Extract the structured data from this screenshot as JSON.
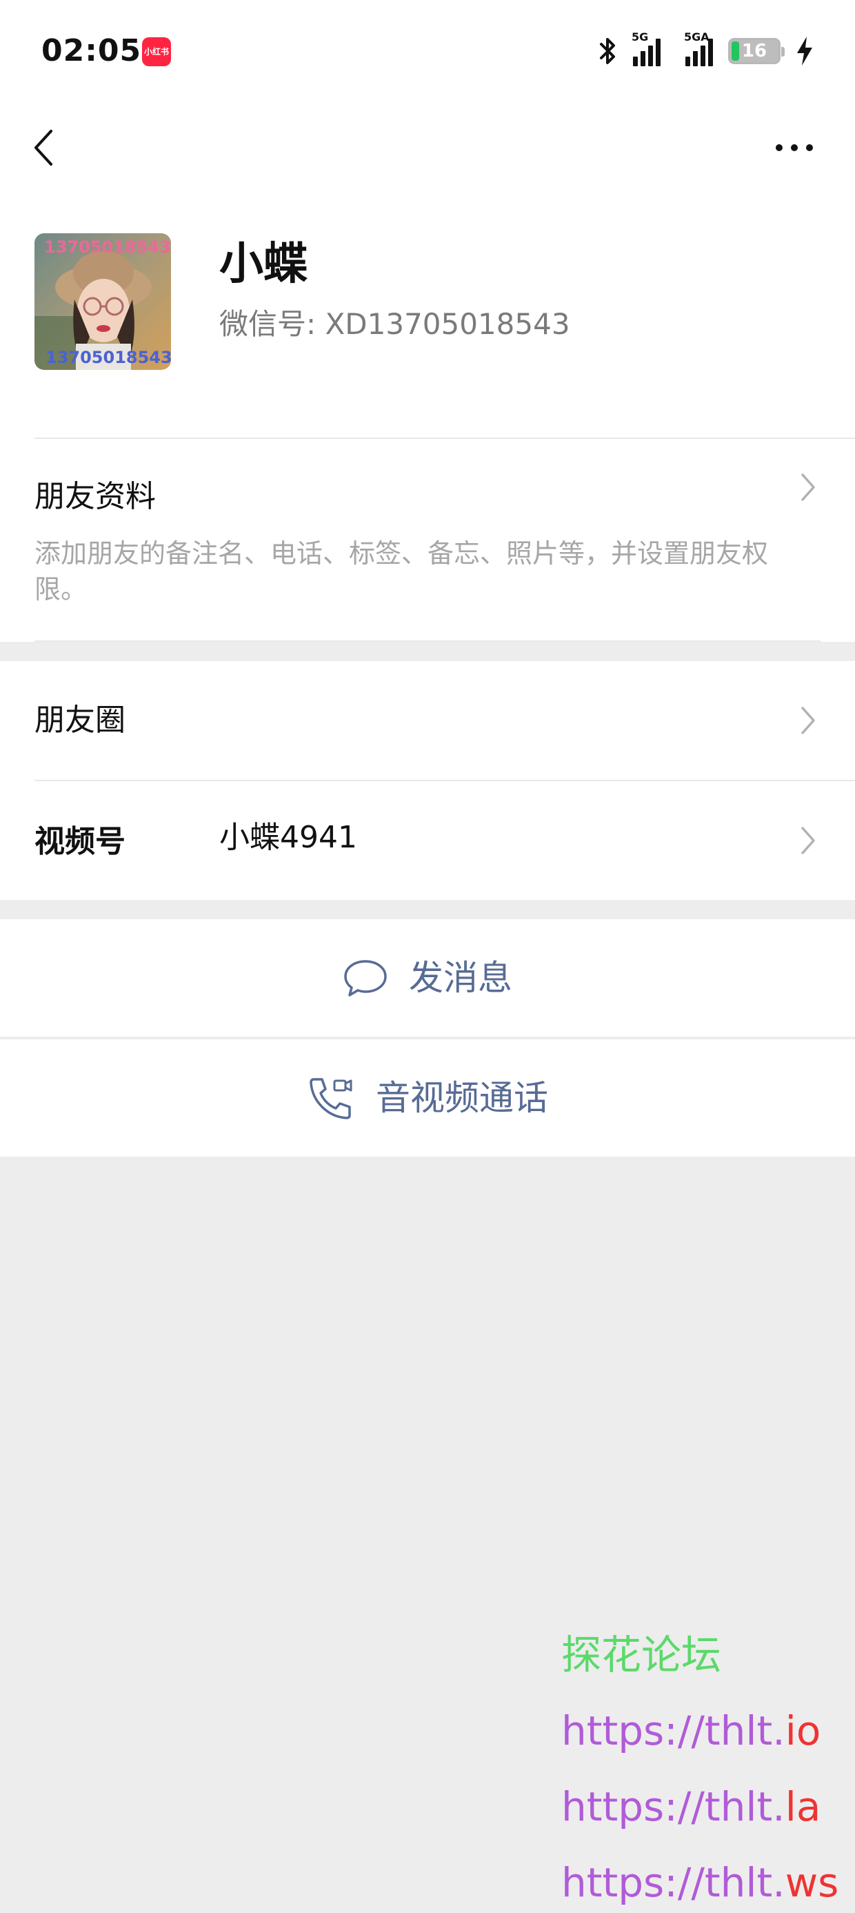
{
  "status_bar": {
    "time": "02:05",
    "app_badge": "小红书",
    "signal1_label": "5G",
    "signal2_label": "5GA",
    "battery": "16",
    "battery_level": 0.16,
    "icons": [
      "bluetooth-icon",
      "signal-5g-icon",
      "signal-5ga-icon",
      "battery-icon",
      "charging-bolt-icon"
    ]
  },
  "nav": {
    "back_icon": "chevron-left-icon",
    "more_icon": "more-dots-icon"
  },
  "profile": {
    "name": "小蝶",
    "wechat_id_label": "微信号: ",
    "wechat_id": "XD13705018543",
    "avatar_watermark_top": "13705018543",
    "avatar_watermark_bottom": "13705018543"
  },
  "friend_info": {
    "title": "朋友资料",
    "desc": "添加朋友的备注名、电话、标签、备忘、照片等，并设置朋友权限。"
  },
  "moments": {
    "title": "朋友圈"
  },
  "channels": {
    "title": "视频号",
    "value": "小蝶4941"
  },
  "actions": {
    "message_label": "发消息",
    "call_label": "音视频通话"
  },
  "watermark": {
    "line1": "探花论坛",
    "line1_color": "#5bd96a",
    "lines": [
      {
        "prefix": "https://thlt.",
        "suffix": "io"
      },
      {
        "prefix": "https://thlt.",
        "suffix": "la"
      },
      {
        "prefix": "https://thlt.",
        "suffix": "ws"
      }
    ]
  },
  "colors": {
    "link_blue": "#576b95",
    "page_bg": "#ededed",
    "secondary_text": "#a6a6a6"
  }
}
